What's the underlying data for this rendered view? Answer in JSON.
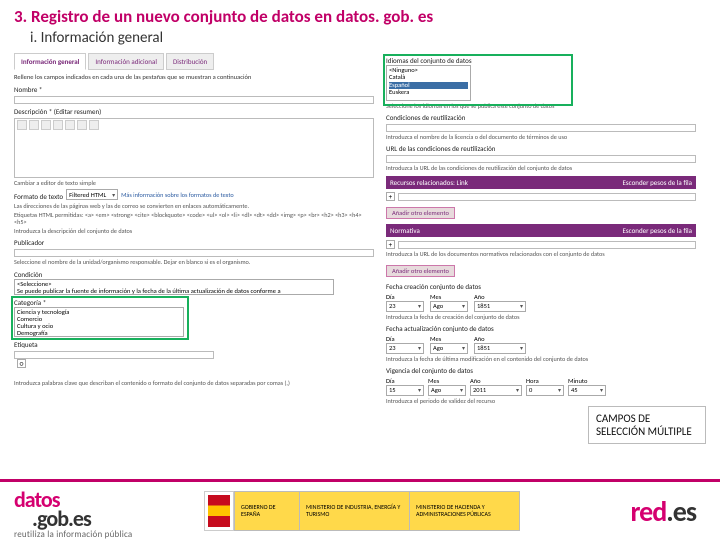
{
  "colors": {
    "accent": "#c10067",
    "purple": "#7a2a7a",
    "green": "#18b05c"
  },
  "title": "3. Registro de un nuevo conjunto de datos en datos. gob. es",
  "subtitle": "i. Información general",
  "tabs": [
    "Información general",
    "Información adicional",
    "Distribución"
  ],
  "intro": "Rellene los campos indicados en cada una de las pestañas que se muestran a continuación",
  "left": {
    "nombre_label": "Nombre *",
    "desc_label": "Descripción * (Editar resumen)",
    "desc_footer": "Cambiar a editor de texto simple",
    "format_label": "Formato de texto",
    "format_value": "Filtered HTML",
    "format_more": "Más información sobre los formatos de texto",
    "format_help": [
      "Las direcciones de las páginas web y las de correo se convierten en enlaces automáticamente.",
      "Etiquetas HTML permitidas: <a> <em> <strong> <cite> <blockquote> <code> <ul> <ol> <li> <dl> <dt> <dd> <img> <p> <br> <h2> <h3> <h4> <h5>"
    ],
    "desc_hint": "Introduzca la descripción del conjunto de datos",
    "publicador_label": "Publicador",
    "publicador_hint": "Seleccione el nombre de la unidad/organismo responsable. Dejar en blanco si es el organismo.",
    "condicion_label": "Condición",
    "condicion_opts": [
      "<Seleccione>",
      "Se puede publicar la fuente de información y la fecha de la última actualización de datos conforme a"
    ],
    "categoria_label": "Categoría *",
    "categoria_opts": [
      "Ciencia y tecnología",
      "Comercio",
      "Cultura y ocio",
      "Demografía"
    ],
    "etiqueta_label": "Etiqueta",
    "etiqueta_hint": "Introduzca palabras clave que describan el contenido o formato del conjunto de datos separadas por comas (,)"
  },
  "right": {
    "idiomas_label": "Idiomas del conjunto de datos",
    "idiomas_opts": [
      "<Ninguno>",
      "Català",
      "Español",
      "Euskera"
    ],
    "idiomas_hint": "Seleccione los idiomas en los que se publica este conjunto de datos",
    "cond_reut_label": "Condiciones de reutilización",
    "cond_reut_hint": "Introduzca el nombre de la licencia o del documento de términos de uso",
    "url_cond_label": "URL de las condiciones de reutilización",
    "url_cond_hint": "Introduzca la URL de las condiciones de reutilización del conjunto de datos",
    "recursos_header": "Recursos relacionados: Link",
    "recursos_hide": "Esconder pesos de la fila",
    "normas_header": "Normativa",
    "normas_hide": "Esconder pesos de la fila",
    "normas_hint": "Introduzca la URL de los documentos normativos relacionados con el conjunto de datos",
    "add_btn": "Añadir otro elemento",
    "fecha_crea_label": "Fecha creación conjunto de datos",
    "fecha_crea_hint": "Introduzca la fecha de creación del conjunto de datos",
    "fecha_act_label": "Fecha actualización conjunto de datos",
    "fecha_act_hint": "Introduzca la fecha de última modificación en el contenido del conjunto de datos",
    "vigencia_label": "Vigencia del conjunto de datos",
    "vigencia_hint": "Introduzca el periodo de validez del recurso",
    "date_cols": [
      "Día",
      "Mes",
      "Año"
    ],
    "time_cols": [
      "Hora",
      "Minuto"
    ],
    "date1": {
      "d": "23",
      "m": "Ago",
      "a": "1851"
    },
    "date2": {
      "d": "23",
      "m": "Ago",
      "a": "1851"
    },
    "date3_from": {
      "d": "15",
      "m": "Ago",
      "a": "2011",
      "h": "0",
      "min": "45"
    }
  },
  "callout": {
    "line1": "CAMPOS DE",
    "line2": "SELECCIÓN MÚLTIPLE"
  },
  "footer": {
    "datos_sub": "reutiliza la información pública",
    "gob": "GOBIERNO\nDE ESPAÑA",
    "min1": "MINISTERIO\nDE INDUSTRIA, ENERGÍA\nY TURISMO",
    "min2": "MINISTERIO\nDE HACIENDA\nY ADMINISTRACIONES PÚBLICAS"
  }
}
